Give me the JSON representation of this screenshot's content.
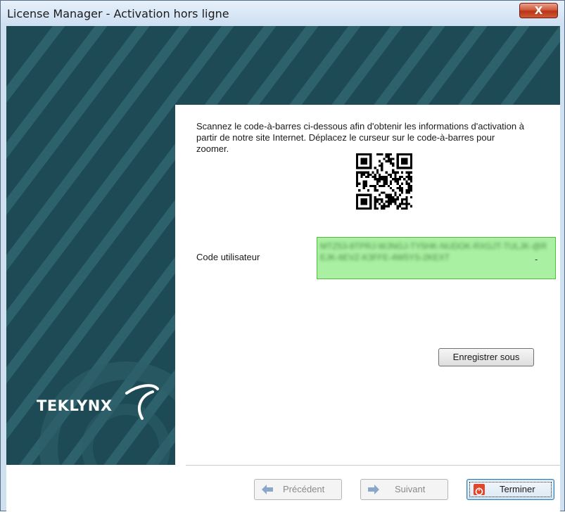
{
  "window": {
    "title": "License Manager - Activation hors ligne",
    "close_label": "X"
  },
  "brand": {
    "logo_text": "TEKLYNX"
  },
  "main": {
    "instructions": "Scannez le code-à-barres ci-dessous afin d'obtenir les informations d'activation à partir de notre site Internet. Déplacez le curseur sur le code-à-barres pour zoomer.",
    "user_code_label": "Code utilisateur",
    "user_code_value_redacted": "MTZ53-8TPRJ-WJNGJ-TY5HK-NUDOK-RXGJT-TULJK-@REJK-6EVZ-K3FFE-4W5YS-2KEXT",
    "save_as_label": "Enregistrer sous"
  },
  "footer": {
    "prev_label": "Précédent",
    "next_label": "Suivant",
    "finish_label": "Terminer"
  },
  "colors": {
    "banner": "#1d4a54",
    "user_code_bg": "#aaf0a2",
    "user_code_border": "#4fbf3a",
    "close_button": "#c5432a"
  }
}
